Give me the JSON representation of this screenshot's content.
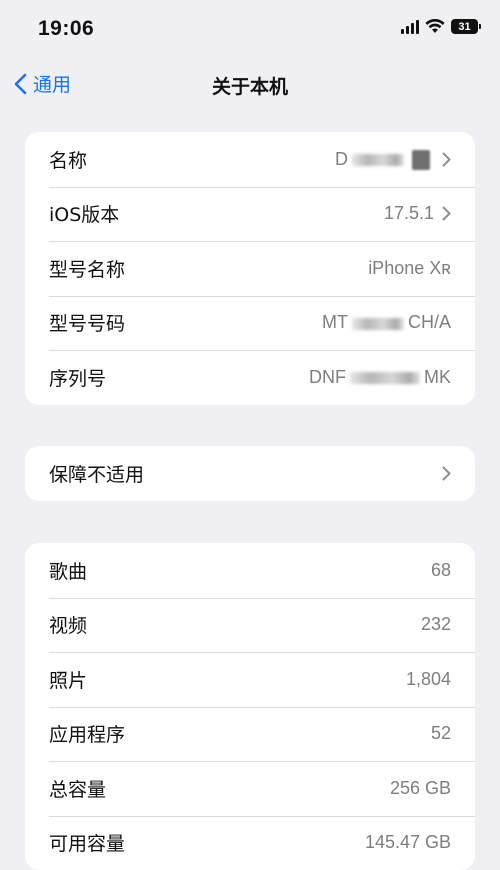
{
  "status_bar": {
    "time": "19:06",
    "battery": "31"
  },
  "nav": {
    "back_label": "通用",
    "title": "关于本机"
  },
  "info_section": [
    {
      "label": "名称",
      "value": "D",
      "redacted": true
    },
    {
      "label": "iOS版本",
      "value": "17.5.1"
    },
    {
      "label": "型号名称",
      "value": "iPhone Xʀ"
    },
    {
      "label": "型号号码",
      "value_start": "MT",
      "value_end": "CH/A",
      "redacted": true
    },
    {
      "label": "序列号",
      "value_start": "DNF",
      "value_end": "MK",
      "redacted": true
    }
  ],
  "warranty": {
    "label": "保障不适用"
  },
  "storage_section": [
    {
      "label": "歌曲",
      "value": "68"
    },
    {
      "label": "视频",
      "value": "232"
    },
    {
      "label": "照片",
      "value": "1,804"
    },
    {
      "label": "应用程序",
      "value": "52"
    },
    {
      "label": "总容量",
      "value": "256 GB"
    },
    {
      "label": "可用容量",
      "value": "145.47 GB"
    }
  ],
  "colors": {
    "accent": "#1a73e8",
    "background": "#f0eff4",
    "card": "#ffffff",
    "secondary_text": "#7e7e82"
  }
}
